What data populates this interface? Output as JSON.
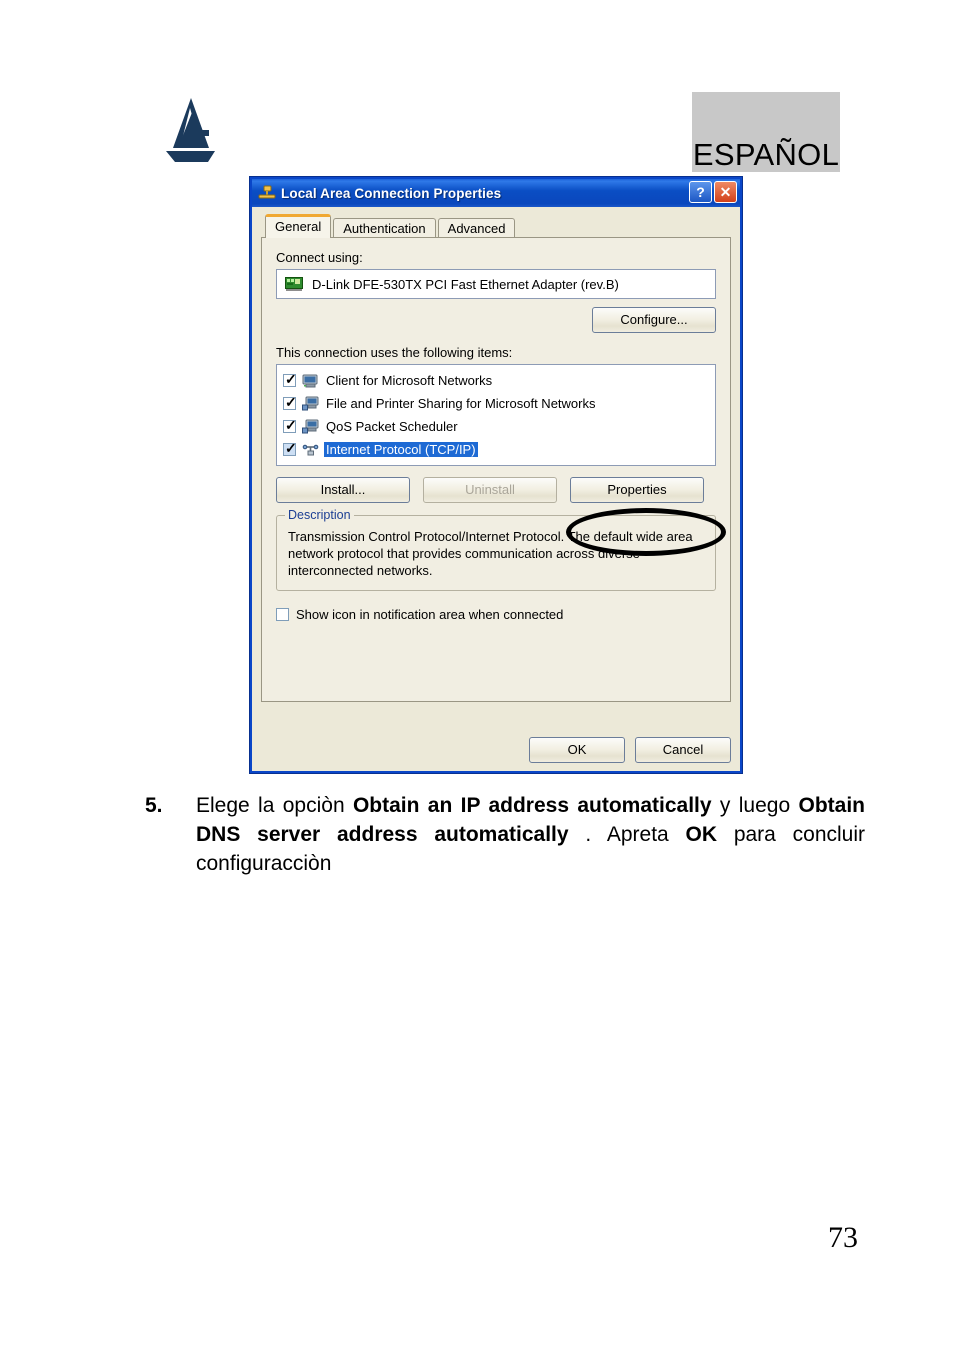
{
  "page": {
    "language_badge": "ESPAÑOL",
    "page_number": "73",
    "logo_name": "atlantis-land-logo"
  },
  "dialog": {
    "title": "Local Area Connection Properties",
    "titlebar_icon": "network-connection-icon",
    "help_button": "?",
    "close_button": "✕",
    "tabs": [
      {
        "label": "General",
        "active": true
      },
      {
        "label": "Authentication",
        "active": false
      },
      {
        "label": "Advanced",
        "active": false
      }
    ],
    "connect_using_label": "Connect using:",
    "adapter": {
      "icon": "network-adapter-icon",
      "name": "D-Link DFE-530TX PCI Fast Ethernet Adapter (rev.B)"
    },
    "configure_button": "Configure...",
    "items_label": "This connection uses the following items:",
    "items": [
      {
        "label": "Client for Microsoft Networks",
        "checked": true,
        "selected": false,
        "icon": "computer-client-icon"
      },
      {
        "label": "File and Printer Sharing for Microsoft Networks",
        "checked": true,
        "selected": false,
        "icon": "computer-sharing-icon"
      },
      {
        "label": "QoS Packet Scheduler",
        "checked": true,
        "selected": false,
        "icon": "computer-qos-icon"
      },
      {
        "label": "Internet Protocol (TCP/IP)",
        "checked": true,
        "selected": true,
        "icon": "protocol-tcpip-icon"
      }
    ],
    "install_button": "Install...",
    "uninstall_button": "Uninstall",
    "properties_button": "Properties",
    "description_legend": "Description",
    "description_text": "Transmission Control Protocol/Internet Protocol. The default wide area network protocol that provides communication across diverse interconnected networks.",
    "notify_checkbox_label": "Show icon in notification area when connected",
    "notify_checked": false,
    "ok_button": "OK",
    "cancel_button": "Cancel"
  },
  "step": {
    "number": "5.",
    "part1": "Elege la opciòn ",
    "bold1": "Obtain an IP address automatically",
    "part2": " y luego ",
    "bold2": "Obtain DNS server address automatically",
    "part3": " . Apreta  ",
    "bold3": "OK",
    "part4": " para concluir configuracciòn"
  },
  "colors": {
    "titlebar_blue": "#0a4ec4",
    "dialog_face": "#ece9d8",
    "selection_blue": "#1e6ad4",
    "badge_gray": "#c8c8c8",
    "logo_navy": "#1b3a5c",
    "tab_accent_orange": "#f0a832",
    "close_red": "#d2401a",
    "annotation_black": "#000000"
  }
}
